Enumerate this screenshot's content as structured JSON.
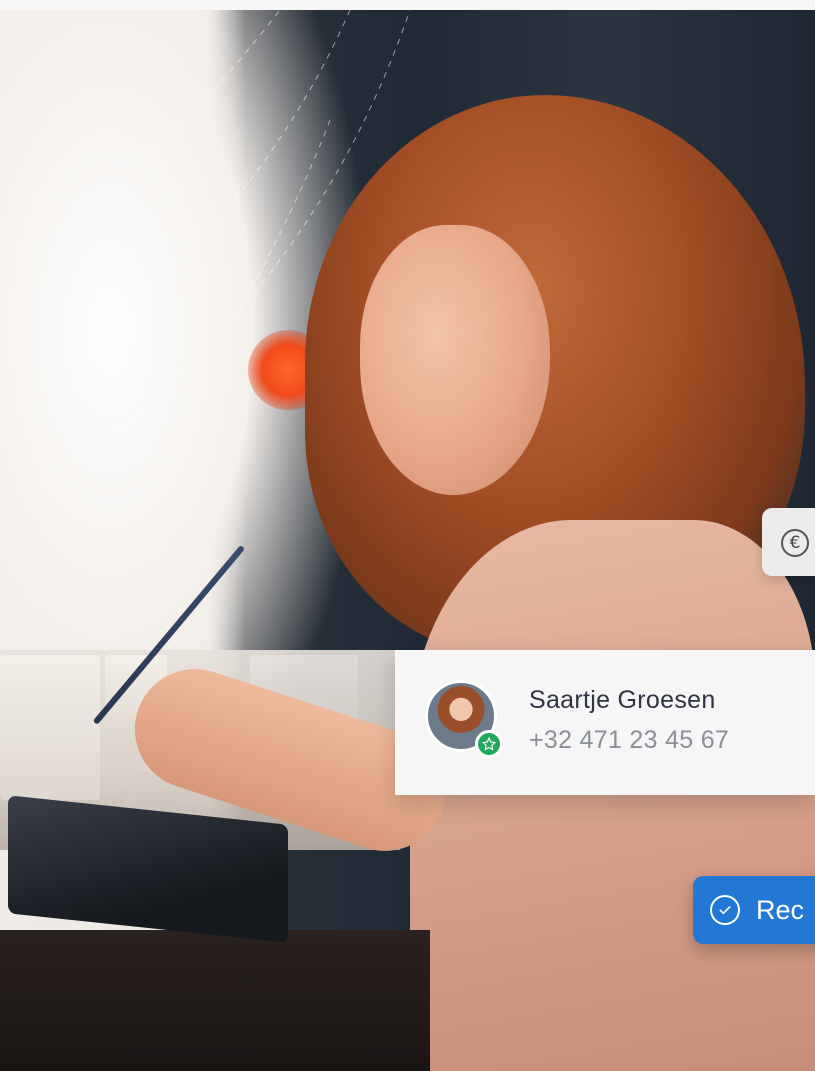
{
  "contact": {
    "name": "Saartje Groesen",
    "phone": "+32 471 23 45 67",
    "badge_icon": "star-icon",
    "badge_color": "#22a85a"
  },
  "euro_chip": {
    "icon": "euro-icon",
    "symbol": "€"
  },
  "action_button": {
    "icon": "check-circle-icon",
    "label": "Rec",
    "color": "#2378d6"
  }
}
